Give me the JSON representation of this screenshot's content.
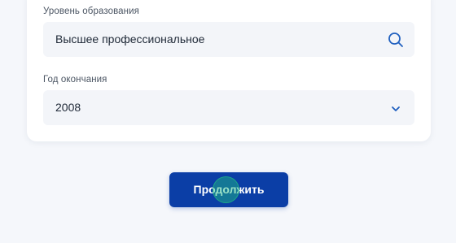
{
  "form": {
    "education_level": {
      "label": "Уровень образования",
      "value": "Высшее профессиональное",
      "icon": "search-icon"
    },
    "graduation_year": {
      "label": "Год окончания",
      "value": "2008",
      "icon": "chevron-down-icon"
    }
  },
  "actions": {
    "continue_label": "Продолжить"
  },
  "colors": {
    "accent": "#0b3ea6",
    "icon": "#1f5fbf",
    "field_bg": "#f3f5f9",
    "page_bg": "#f5f7fb"
  }
}
